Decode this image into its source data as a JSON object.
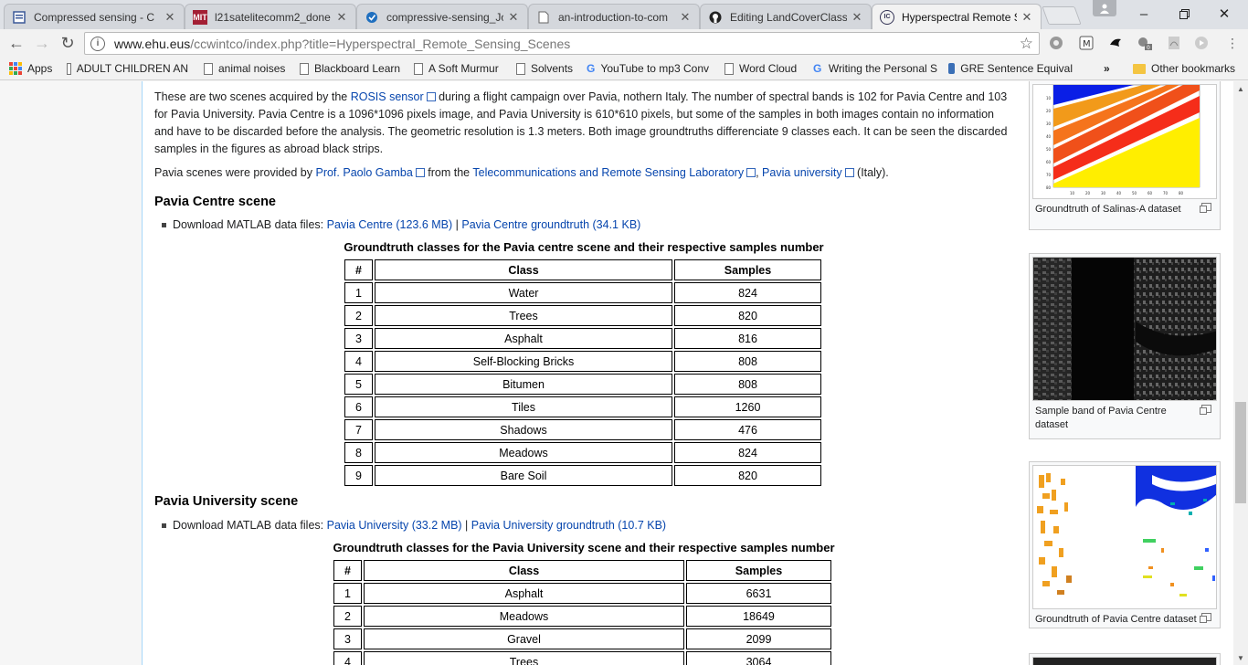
{
  "tabs": [
    {
      "title": "Compressed sensing - C",
      "favicon": "doc"
    },
    {
      "title": "l21satelitecomm2_done",
      "favicon": "mit"
    },
    {
      "title": "compressive-sensing_Jo",
      "favicon": "shield"
    },
    {
      "title": "an-introduction-to-com",
      "favicon": "page"
    },
    {
      "title": "Editing LandCoverClassi",
      "favicon": "github"
    },
    {
      "title": "Hyperspectral Remote S",
      "favicon": "ic"
    }
  ],
  "address": {
    "domain": "www.ehu.eus",
    "path": "/ccwintco/index.php?title=Hyperspectral_Remote_Sensing_Scenes"
  },
  "bookmarks": [
    {
      "label": "Apps",
      "type": "apps"
    },
    {
      "label": "ADULT CHILDREN AN",
      "type": "page"
    },
    {
      "label": "animal noises",
      "type": "page"
    },
    {
      "label": "Blackboard Learn",
      "type": "page"
    },
    {
      "label": "A Soft Murmur",
      "type": "page"
    },
    {
      "label": "Solvents",
      "type": "page"
    },
    {
      "label": "YouTube to mp3 Conv",
      "type": "google"
    },
    {
      "label": "Word Cloud",
      "type": "page"
    },
    {
      "label": "Writing the Personal S",
      "type": "google"
    },
    {
      "label": "GRE Sentence Equival",
      "type": "gre"
    }
  ],
  "bookmarks_overflow": "»",
  "other_bookmarks": "Other bookmarks",
  "intro": {
    "p1_a": "These are two scenes acquired by the ",
    "p1_link": "ROSIS sensor",
    "p1_b": " during a flight campaign over Pavia, nothern Italy. The number of spectral bands is 102 for Pavia Centre and 103 for Pavia University. Pavia Centre is a 1096*1096 pixels image, and Pavia University is 610*610 pixels, but some of the samples in both images contain no information and have to be discarded before the analysis. The geometric resolution is 1.3 meters. Both image groundtruths differenciate 9 classes each. It can be seen the discarded samples in the figures as abroad black strips.",
    "p2_a": "Pavia scenes were provided by ",
    "p2_link1": "Prof. Paolo Gamba",
    "p2_b": " from the ",
    "p2_link2": "Telecommunications and Remote Sensing Laboratory",
    "p2_c": ", ",
    "p2_link3": "Pavia university",
    "p2_d": " (Italy)."
  },
  "centre": {
    "heading": "Pavia Centre scene",
    "download_prefix": "Download MATLAB data files: ",
    "link1": "Pavia Centre (123.6 MB)",
    "sep": " | ",
    "link2": "Pavia Centre groundtruth (34.1 KB)",
    "caption": "Groundtruth classes for the Pavia centre scene and their respective samples number",
    "headers": [
      "#",
      "Class",
      "Samples"
    ],
    "rows": [
      [
        "1",
        "Water",
        "824"
      ],
      [
        "2",
        "Trees",
        "820"
      ],
      [
        "3",
        "Asphalt",
        "816"
      ],
      [
        "4",
        "Self-Blocking Bricks",
        "808"
      ],
      [
        "5",
        "Bitumen",
        "808"
      ],
      [
        "6",
        "Tiles",
        "1260"
      ],
      [
        "7",
        "Shadows",
        "476"
      ],
      [
        "8",
        "Meadows",
        "824"
      ],
      [
        "9",
        "Bare Soil",
        "820"
      ]
    ]
  },
  "university": {
    "heading": "Pavia University scene",
    "download_prefix": "Download MATLAB data files: ",
    "link1": "Pavia University (33.2 MB)",
    "sep": " | ",
    "link2": "Pavia University groundtruth (10.7 KB)",
    "caption": "Groundtruth classes for the Pavia University scene and their respective samples number",
    "headers": [
      "#",
      "Class",
      "Samples"
    ],
    "rows": [
      [
        "1",
        "Asphalt",
        "6631"
      ],
      [
        "2",
        "Meadows",
        "18649"
      ],
      [
        "3",
        "Gravel",
        "2099"
      ],
      [
        "4",
        "Trees",
        "3064"
      ]
    ]
  },
  "thumbnails": [
    {
      "caption": "Groundtruth of Salinas-A dataset",
      "axis_ticks": [
        "10",
        "20",
        "30",
        "40",
        "50",
        "60",
        "70",
        "80"
      ]
    },
    {
      "caption": "Sample band of Pavia Centre dataset"
    },
    {
      "caption": "Groundtruth of Pavia Centre dataset"
    }
  ]
}
